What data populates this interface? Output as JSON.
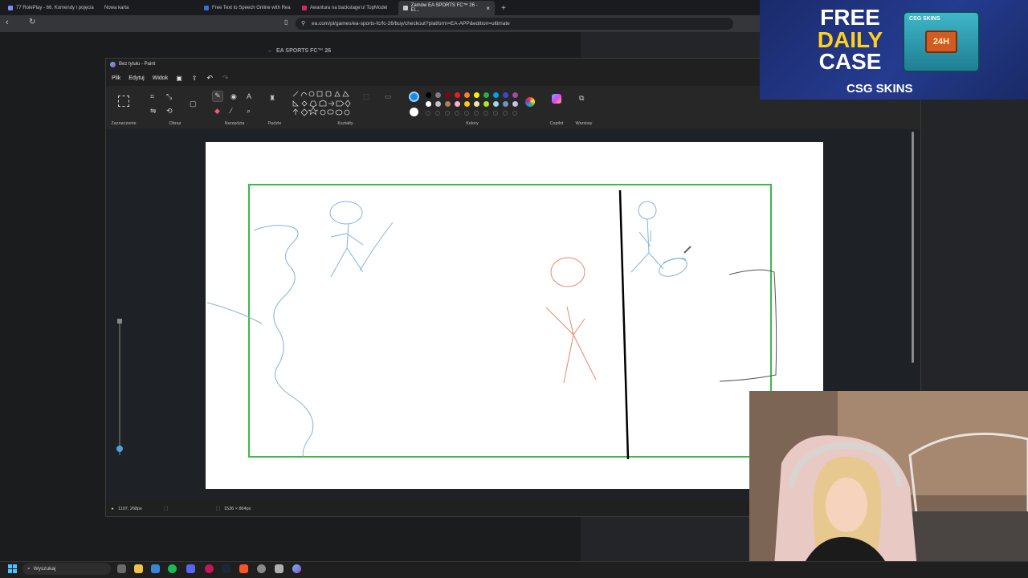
{
  "browser": {
    "tabs": [
      {
        "label": "77 RolePlay - 66. Komendy i pojęcia",
        "color": "#7b8cff"
      },
      {
        "label": "Nowa karta",
        "color": "#5f6368"
      },
      {
        "label": "Free Text to Speech Online with Rea",
        "color": "#3b6fe0"
      },
      {
        "label": "Awantura na backstage'u! TopModel",
        "color": "#e0245e"
      },
      {
        "label": "Zamów EA SPORTS FC™ 26 - El...",
        "color": "#c9c9c9"
      }
    ],
    "url": "ea.com/pl/games/ea-sports-fc/fc-26/buy/checkout?platform=EA-APP&edition=ultimate",
    "page_back_label": "EA SPORTS FC™ 26"
  },
  "paint": {
    "title": "Bez tytułu - Paint",
    "menu": [
      "Plik",
      "Edytuj",
      "Widok"
    ],
    "groups": {
      "selection": "Zaznaczenie",
      "image": "Obraz",
      "tools": "Narzędzia",
      "brushes": "Pędzle",
      "shapes": "Kształty",
      "colors": "Kolory",
      "copilot": "Copilot",
      "layers": "Warstwy"
    },
    "status": {
      "cursor_pos": "1197, 268px",
      "canvas_size": "1536 × 864px"
    },
    "palette_row1": [
      "#000000",
      "#7f7f7f",
      "#880015",
      "#ed1c24",
      "#ff7f27",
      "#fff200",
      "#22b14c",
      "#00a2e8",
      "#3f48cc",
      "#a349a4"
    ],
    "palette_row2": [
      "#ffffff",
      "#c3c3c3",
      "#b97a57",
      "#ffaec9",
      "#ffc90e",
      "#efe4b0",
      "#b5e61d",
      "#99d9ea",
      "#7092be",
      "#c8bfe7"
    ],
    "primary_color": "#1e88e5",
    "secondary_color": "#ffffff"
  },
  "ad": {
    "line1": "FREE",
    "line2": "DAILY",
    "line3": "CASE",
    "brand": "CSG SKINS",
    "crate_label": "24H",
    "crate_brand": "CSG SKINS"
  },
  "taskbar": {
    "search_placeholder": "Wyszukaj"
  }
}
